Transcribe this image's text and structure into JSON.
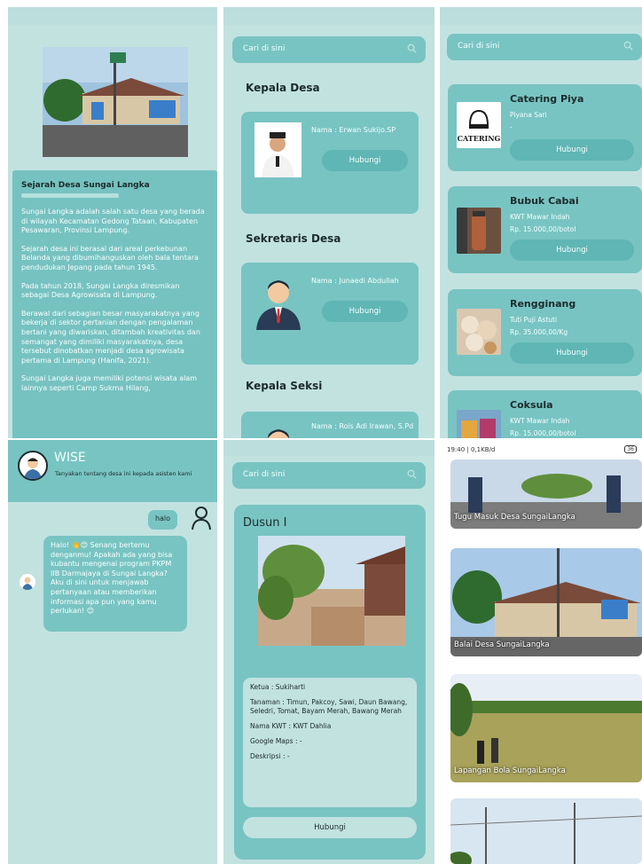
{
  "history": {
    "title": "Sejarah Desa Sungai Langka",
    "paragraphs": [
      "Sungai Langka adalah salah satu desa yang berada di wilayah Kecamatan Gedong Tataan, Kabupaten Pesawaran, Provinsi Lampung.",
      "Sejarah desa ini berasal dari areal perkebunan Belanda yang dibumihanguskan oleh bala tentara pendudukan Jepang pada tahun 1945.",
      "Pada tahun 2018, Sungai Langka diresmikan sebagai Desa Agrowisata di Lampung.",
      "Berawal dari sebagian besar masyarakatnya yang bekerja di sektor pertanian dengan pengalaman bertani yang diwariskan, ditambah kreativitas dan semangat yang dimiliki masyarakatnya, desa tersebut dinobatkan menjadi desa agrowisata pertama di Lampung (Hanifa, 2021).",
      "Sungai Langka juga memiliki potensi wisata alam lainnya seperti Camp Sukma Hilang,"
    ]
  },
  "officials": {
    "search_placeholder": "Cari di sini",
    "sections": [
      {
        "heading": "Kepala Desa",
        "name": "Nama : Erwan Sukijo.SP",
        "button": "Hubungi"
      },
      {
        "heading": "Sekretaris Desa",
        "name": "Nama : Junaedi Abdullah",
        "button": "Hubungi"
      },
      {
        "heading": "Kepala Seksi",
        "name": "Nama : Rois Adi Irawan, S.Pd",
        "button": "Hubungi"
      }
    ]
  },
  "products": {
    "search_placeholder": "Cari di sini",
    "items": [
      {
        "name": "Catering Piya",
        "seller": "Piyana Sari",
        "price": "-",
        "button": "Hubungi",
        "img_text": "CATERING"
      },
      {
        "name": "Bubuk Cabai",
        "seller": "KWT Mawar Indah",
        "price": "Rp. 15.000,00/botol",
        "button": "Hubungi"
      },
      {
        "name": "Rengginang",
        "seller": "Tuti Puji Astuti",
        "price": "Rp. 35.000,00/Kg",
        "button": "Hubungi"
      },
      {
        "name": "Coksula",
        "seller": "KWT Mawar Indah",
        "price": "Rp. 15.000,00/botol"
      }
    ]
  },
  "chat": {
    "title": "WISE",
    "subtitle": "Tanyakan tentang desa ini kepada asisten kami",
    "user_message": "halo",
    "bot_message": "Halo! 👋😊 Senang bertemu denganmu! Apakah ada yang bisa kubantu mengenai program PKPM IIB Darmajaya di Sungai Langka? Aku di sini untuk menjawab pertanyaan atau memberikan informasi apa pun yang kamu perlukan! 😊"
  },
  "dusun": {
    "search_placeholder": "Cari di sini",
    "title": "Dusun I",
    "ketua": "Ketua : Sukiharti",
    "tanaman": "Tanaman : Timun, Pakcoy, Sawi, Daun Bawang, Seledri, Tomat, Bayam Merah, Bawang Merah",
    "kwt": "Nama KWT : KWT Dahlia",
    "maps": "Google Maps : -",
    "deskripsi": "Deskripsi : -",
    "button": "Hubungi"
  },
  "gallery": {
    "status_left": "19:40 | 0,1KB/d",
    "status_right": "36",
    "items": [
      {
        "label": "Tugu Masuk Desa SungaiLangka"
      },
      {
        "label": "Balai Desa SungaiLangka"
      },
      {
        "label": "Lapangan Bola SungaiLangka"
      }
    ]
  },
  "colors": {
    "card": "#78c4c2",
    "background": "#c2e2e0",
    "button": "#5fb6b4"
  }
}
